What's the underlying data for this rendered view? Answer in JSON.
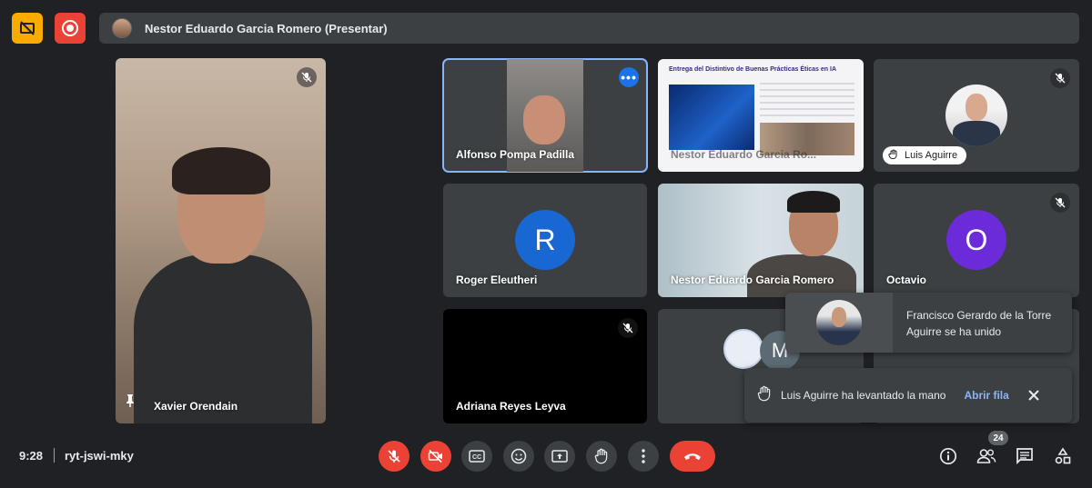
{
  "top": {
    "presenter_text": "Nestor Eduardo Garcia Romero (Presentar)"
  },
  "tiles": {
    "xavier": "Xavier Orendain",
    "alfonso": "Alfonso Pompa Padilla",
    "nestor_presentation": "Nestor Eduardo Garcia Ro...",
    "slide_title": "Entrega del Distintivo de Buenas Prácticas Éticas en IA",
    "luis": "Luis Aguirre",
    "roger": "Roger Eleutheri",
    "roger_initial": "R",
    "nestor_camera": "Nestor Eduardo Garcia Romero",
    "octavio": "Octavio",
    "octavio_initial": "O",
    "adriana": "Adriana Reyes Leyva",
    "m_initial": "M"
  },
  "notifications": {
    "joined": "Francisco Gerardo de la Torre Aguirre se ha unido",
    "hand_raised": "Luis Aguirre ha levantado la mano",
    "open_queue": "Abrir fila"
  },
  "bottom": {
    "time": "9:28",
    "meeting_code": "ryt-jswi-mky",
    "participants_count": "24"
  },
  "colors": {
    "accent_blue": "#8ab4f8",
    "danger_red": "#ea4335",
    "warning_yellow": "#f9ab00",
    "roger_avatar": "#1967d2",
    "octavio_avatar": "#6c2bd9"
  }
}
